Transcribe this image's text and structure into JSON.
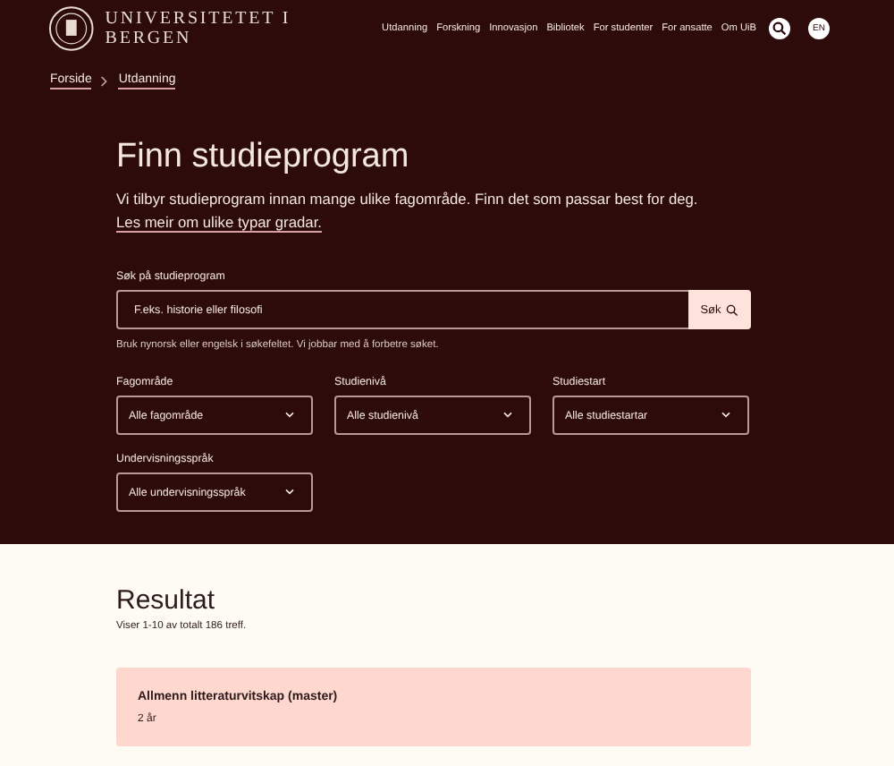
{
  "header": {
    "logo_text": "UNIVERSITETET I BERGEN",
    "nav": [
      "Utdanning",
      "Forskning",
      "Innovasjon",
      "Bibliotek",
      "For studenter",
      "For ansatte",
      "Om UiB"
    ],
    "language_button": "EN"
  },
  "breadcrumb": [
    "Forside",
    "Utdanning"
  ],
  "hero": {
    "title": "Finn studieprogram",
    "intro": "Vi tilbyr studieprogram innan mange ulike fagområde. Finn det som passar best for deg.",
    "intro_link": "Les meir om ulike typar gradar.",
    "search": {
      "label": "Søk på studieprogram",
      "placeholder": "F.eks. historie eller filosofi",
      "button": "Søk",
      "help": "Bruk nynorsk eller engelsk i søkefeltet. Vi jobbar med å forbetre søket."
    },
    "filters": [
      {
        "label": "Fagområde",
        "value": "Alle fagområde"
      },
      {
        "label": "Studienivå",
        "value": "Alle studienivå"
      },
      {
        "label": "Studiestart",
        "value": "Alle studiestartar"
      },
      {
        "label": "Undervisningsspråk",
        "value": "Alle undervisningsspråk"
      }
    ]
  },
  "results": {
    "title": "Resultat",
    "count": "Viser 1-10 av totalt 186 treff.",
    "items": [
      {
        "title": "Allmenn litteraturvitskap (master)",
        "duration": "2 år"
      }
    ]
  }
}
